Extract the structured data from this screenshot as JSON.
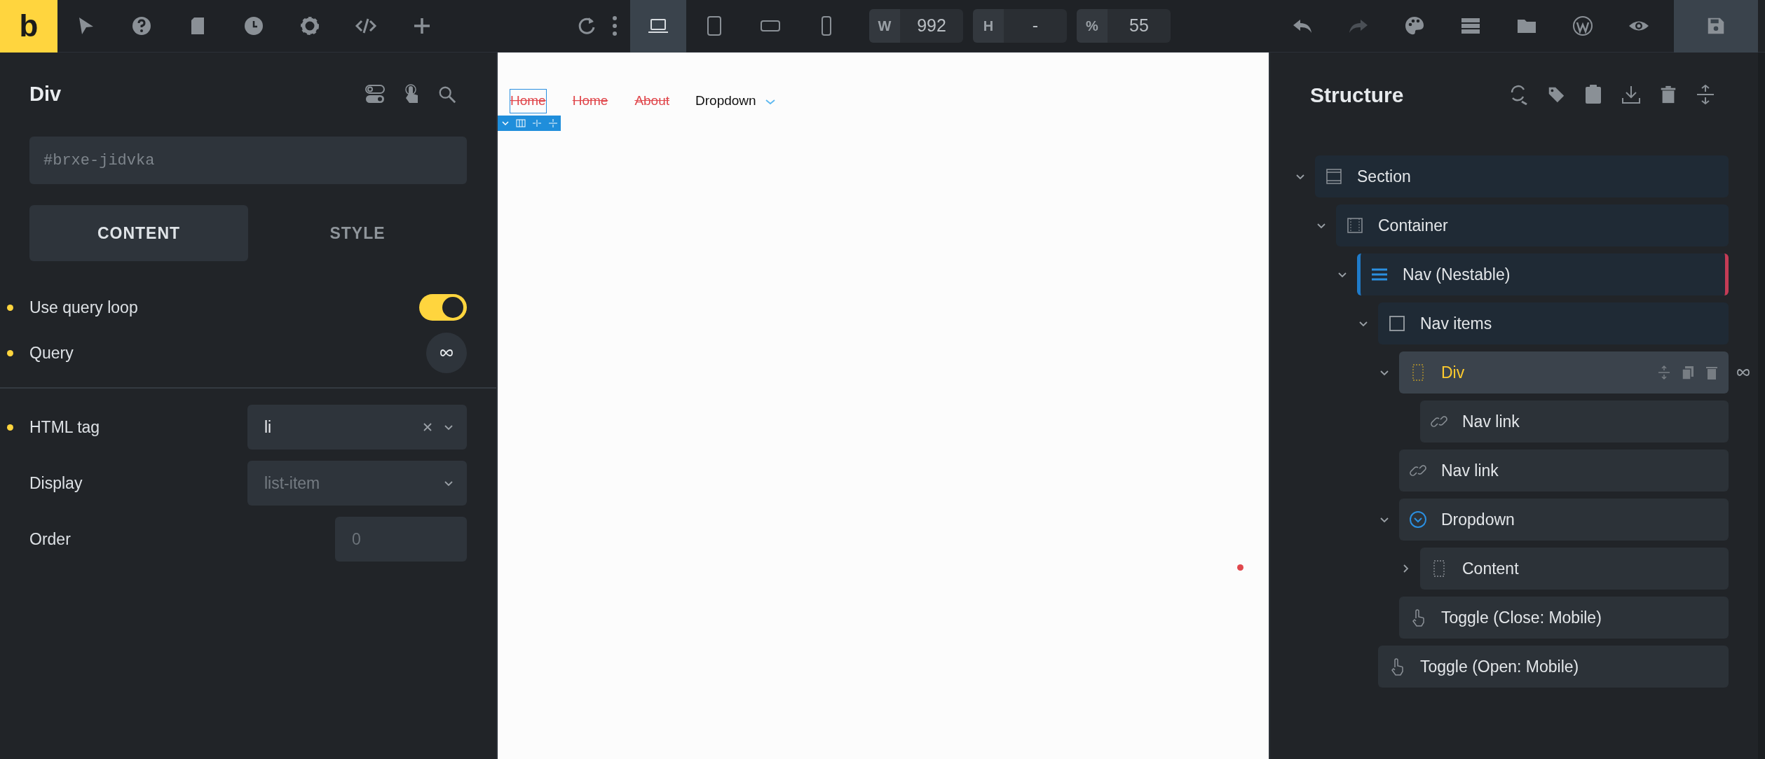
{
  "toolbar": {
    "logo": "b",
    "devices": [
      {
        "kind": "laptop",
        "selected": true
      },
      {
        "kind": "tablet",
        "selected": false
      },
      {
        "kind": "landscape",
        "selected": false
      },
      {
        "kind": "phone",
        "selected": false
      }
    ],
    "size_fields": [
      {
        "label": "W",
        "value": "992"
      },
      {
        "label": "H",
        "value": "-"
      },
      {
        "label": "%",
        "value": "55"
      }
    ],
    "history": [
      {
        "kind": "undo",
        "disabled": false
      },
      {
        "kind": "redo",
        "disabled": true
      }
    ]
  },
  "panel": {
    "title": "Div",
    "id_placeholder": "#brxe-jidvka",
    "tabs": [
      {
        "label": "CONTENT",
        "selected": true
      },
      {
        "label": "STYLE",
        "selected": false
      }
    ],
    "groups": [
      {
        "controls": [
          {
            "kind": "toggle",
            "label": "Use query loop",
            "modified": true,
            "on": true
          },
          {
            "kind": "query",
            "label": "Query",
            "modified": true
          }
        ]
      },
      {
        "controls": [
          {
            "kind": "select",
            "label": "HTML tag",
            "value": "li",
            "modified": true
          },
          {
            "kind": "select",
            "label": "Display",
            "placeholder": "list-item",
            "modified": false
          },
          {
            "kind": "number",
            "label": "Order",
            "placeholder": "0",
            "modified": false
          }
        ]
      }
    ]
  },
  "canvas": {
    "nav_items": [
      {
        "kind": "link",
        "label": "Home",
        "selected": true
      },
      {
        "kind": "link",
        "label": "Home",
        "selected": false
      },
      {
        "kind": "link",
        "label": "About",
        "selected": false
      },
      {
        "kind": "dropdown",
        "label": "Dropdown",
        "selected": false
      }
    ]
  },
  "structure": {
    "title": "Structure",
    "tree": [
      {
        "kind": "section",
        "label": "Section",
        "expanded": true,
        "selected": false,
        "loop": false,
        "children": [
          {
            "kind": "container",
            "label": "Container",
            "expanded": true,
            "selected": false,
            "loop": false,
            "children": [
              {
                "kind": "nav",
                "label": "Nav (Nestable)",
                "expanded": true,
                "selected": false,
                "loop": false,
                "children": [
                  {
                    "kind": "block",
                    "label": "Nav items",
                    "expanded": true,
                    "selected": false,
                    "loop": false,
                    "children": [
                      {
                        "kind": "div",
                        "label": "Div",
                        "expanded": true,
                        "selected": true,
                        "loop": true,
                        "children": [
                          {
                            "kind": "link",
                            "label": "Nav link",
                            "selected": false,
                            "loop": false
                          }
                        ]
                      },
                      {
                        "kind": "link",
                        "label": "Nav link",
                        "selected": false,
                        "loop": false
                      },
                      {
                        "kind": "dropdown",
                        "label": "Dropdown",
                        "expanded": true,
                        "selected": false,
                        "loop": false,
                        "children": [
                          {
                            "kind": "div",
                            "label": "Content",
                            "expanded": false,
                            "selected": false,
                            "loop": false
                          }
                        ]
                      },
                      {
                        "kind": "toggle",
                        "label": "Toggle (Close: Mobile)",
                        "selected": false,
                        "loop": false
                      }
                    ]
                  },
                  {
                    "kind": "toggle",
                    "label": "Toggle (Open: Mobile)",
                    "selected": false,
                    "loop": false
                  }
                ]
              }
            ]
          }
        ]
      }
    ]
  }
}
